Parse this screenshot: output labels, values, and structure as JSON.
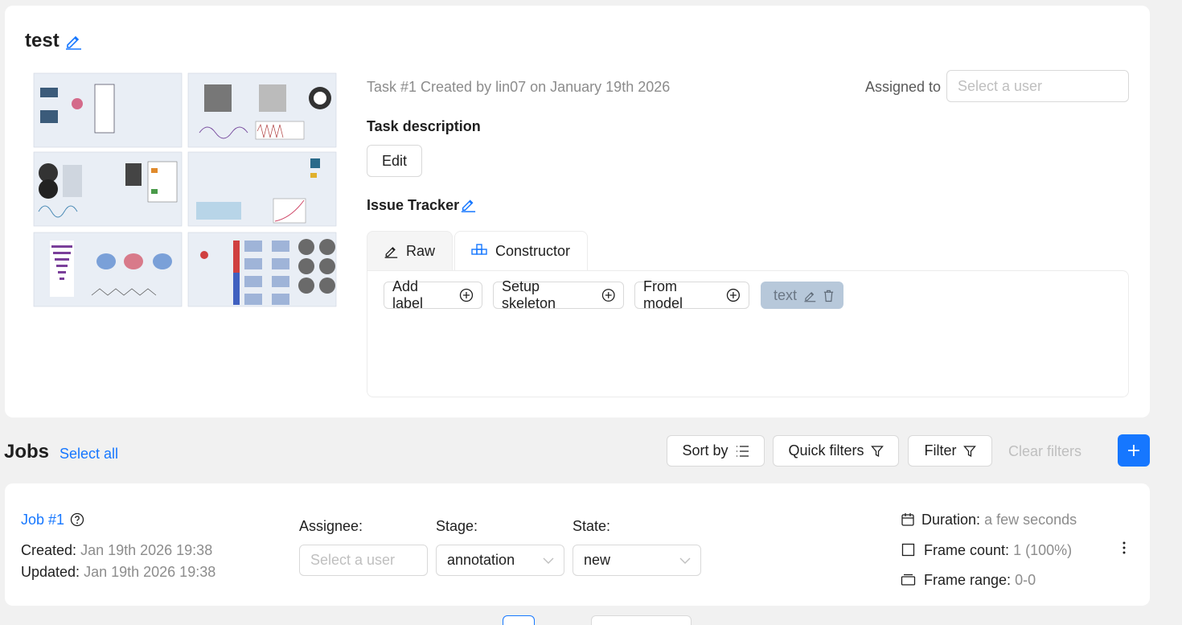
{
  "task": {
    "title": "test",
    "meta": "Task #1 Created by lin07 on January 19th 2026",
    "assigned_label": "Assigned to",
    "assigned_placeholder": "Select a user",
    "description_label": "Task description",
    "edit_label": "Edit",
    "issue_tracker_label": "Issue Tracker",
    "tabs": [
      {
        "label": "Raw",
        "icon": "pencil-icon",
        "active": false
      },
      {
        "label": "Constructor",
        "icon": "constructor-icon",
        "active": true
      }
    ],
    "constructor": {
      "add_label": "Add label",
      "setup_skeleton": "Setup skeleton",
      "from_model": "From model",
      "labels": [
        {
          "name": "text",
          "color": "#b7c8da"
        }
      ]
    }
  },
  "jobs": {
    "title": "Jobs",
    "select_all": "Select all",
    "sort_by": "Sort by",
    "quick_filters": "Quick filters",
    "filter": "Filter",
    "clear_filters": "Clear filters",
    "items": [
      {
        "name": "Job #1",
        "created_label": "Created:",
        "created": "Jan 19th 2026 19:38",
        "updated_label": "Updated:",
        "updated": "Jan 19th 2026 19:38",
        "assignee_label": "Assignee:",
        "assignee_placeholder": "Select a user",
        "stage_label": "Stage:",
        "stage": "annotation",
        "state_label": "State:",
        "state": "new",
        "duration_label": "Duration:",
        "duration": "a few seconds",
        "frame_count_label": "Frame count:",
        "frame_count": "1 (100%)",
        "frame_range_label": "Frame range:",
        "frame_range": "0-0"
      }
    ]
  },
  "colors": {
    "accent": "#1677ff",
    "muted": "#8c8c8c",
    "label_chip": "#b7c8da"
  }
}
